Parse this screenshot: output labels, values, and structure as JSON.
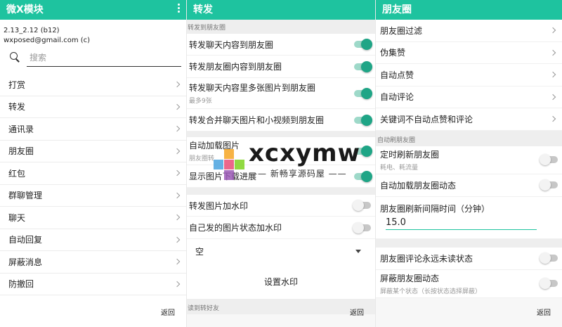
{
  "colors": {
    "accent": "#1ec39f",
    "switch_on": "#1fa586"
  },
  "panel1": {
    "title": "微X模块",
    "version": "2.13_2.12 (b12)",
    "email": "wxposed@gmail.com (c)",
    "search_placeholder": "搜索",
    "items": [
      "打赏",
      "转发",
      "通讯录",
      "朋友圈",
      "红包",
      "群聊管理",
      "聊天",
      "自动回复",
      "屏蔽消息",
      "防撤回"
    ],
    "back": "返回"
  },
  "panel2": {
    "title": "转发",
    "section1": "转发到朋友圈",
    "rows1": [
      {
        "title": "转发聊天内容到朋友圈",
        "on": true
      },
      {
        "title": "转发朋友圈内容到朋友圈",
        "on": true
      },
      {
        "title": "转发聊天内容里多张图片到朋友圈",
        "sub": "最多9张",
        "on": true
      },
      {
        "title": "转发合并聊天图片和小视频到朋友圈",
        "on": true
      }
    ],
    "rows2": [
      {
        "title": "自动加载图片",
        "sub": "朋友圈转",
        "on": true
      },
      {
        "title": "显示图片下载进展",
        "on": true
      }
    ],
    "rows3": [
      {
        "title": "转发图片加水印",
        "on": false
      },
      {
        "title": "自己发的图片状态加水印",
        "on": false
      }
    ],
    "dropdown_value": "空",
    "set_watermark": "设置水印",
    "section2": "读到转好友",
    "back": "返回"
  },
  "panel3": {
    "title": "朋友圈",
    "items": [
      "朋友圈过滤",
      "伪集赞",
      "自动点赞",
      "自动评论",
      "关键词不自动点赞和评论"
    ],
    "section": "自动刷朋友圈",
    "rows1": [
      {
        "title": "定时刷新朋友圈",
        "sub": "耗电、耗流量",
        "on": false
      },
      {
        "title": "自动加载朋友圈动态",
        "on": false
      }
    ],
    "interval_label": "朋友圈刷新间隔时间（分钟）",
    "interval_value": "15.0",
    "rows2": [
      {
        "title": "朋友圈评论永远未读状态",
        "on": false
      },
      {
        "title": "屏蔽朋友圈动态",
        "sub": "屏蔽某个状态（长按状态选择屏蔽）",
        "on": false
      }
    ],
    "back": "返回"
  },
  "watermark": {
    "text": "xcxymw",
    "sub": "—— 新畅享源码屋 ——"
  }
}
